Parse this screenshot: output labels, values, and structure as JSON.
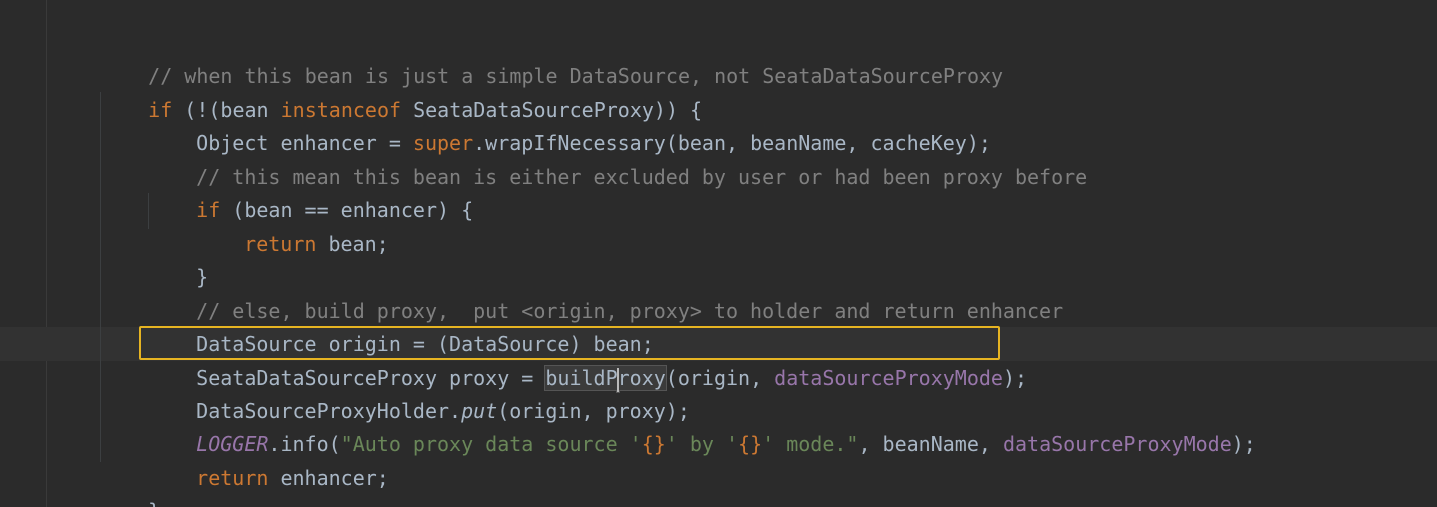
{
  "code": {
    "lines": [
      {
        "comment": "// when this bean is just a simple DataSource, not SeataDataSourceProxy"
      },
      {
        "kw_if": "if",
        "p1": " (!(bean ",
        "kw_instanceof": "instanceof",
        "p2": " SeataDataSourceProxy)) {"
      },
      {
        "p1": "Object enhancer = ",
        "kw_super": "super",
        "p2": ".wrapIfNecessary(bean, beanName, cacheKey);"
      },
      {
        "comment": "// this mean this bean is either excluded by user or had been proxy before"
      },
      {
        "kw_if": "if",
        "p1": " (bean == enhancer) {"
      },
      {
        "kw_return": "return",
        "p1": " bean;"
      },
      {
        "p1": "}"
      },
      {
        "comment": "// else, build proxy,  put <origin, proxy> to holder and return enhancer"
      },
      {
        "p1": "DataSource origin = (DataSource) bean;"
      },
      {
        "p1": "SeataDataSourceProxy proxy = ",
        "word_a": "buildP",
        "word_b": "roxy",
        "p2": "(origin, ",
        "field": "dataSourceProxyMode",
        "p3": ");"
      },
      {
        "p1": "DataSourceProxyHolder.",
        "static_call": "put",
        "p2": "(origin, proxy);"
      },
      {
        "static_field": "LOGGER",
        "p1": ".info(",
        "s1": "\"Auto proxy data source '",
        "s_ph1": "{}",
        "s2": "' by '",
        "s_ph2": "{}",
        "s3": "' mode.\"",
        "p2": ", beanName, ",
        "field": "dataSourceProxyMode",
        "p3": ");"
      },
      {
        "kw_return": "return",
        "p1": " enhancer;"
      },
      {
        "p1": "}"
      }
    ]
  },
  "colors": {
    "background": "#2b2b2b",
    "keyword": "#cc7832",
    "comment": "#808080",
    "plain": "#a9b7c6",
    "field": "#9876aa",
    "string": "#6a8759",
    "highlight_border": "#e6b422"
  }
}
